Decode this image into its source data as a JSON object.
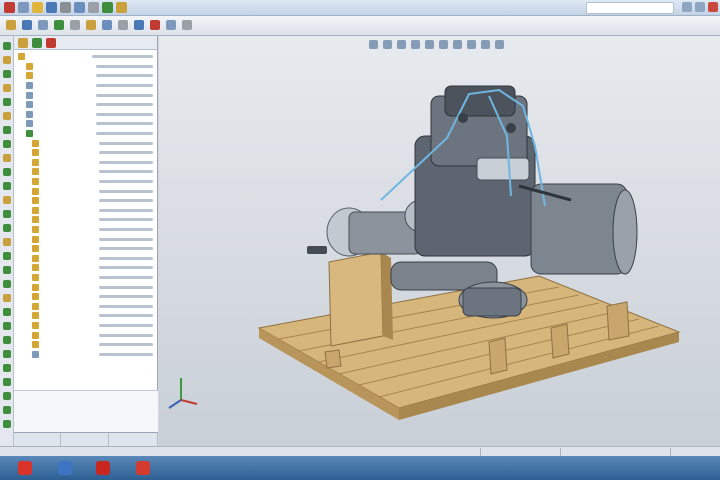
{
  "window": {
    "title": ""
  },
  "colors": {
    "accent": "#3e8e3e",
    "wood": "#d7b67c",
    "wood_shade": "#a9884f",
    "engine": "#8c939c",
    "engine_dark": "#454c56",
    "pipes": "#6fb6e0",
    "viewport_top": "#e7eaee",
    "viewport_bottom": "#c9cfd7"
  },
  "feature_tree": {
    "rows": [
      {
        "icon": "assembly-icon",
        "color": "#d4a636",
        "text": ""
      },
      {
        "icon": "folder-icon",
        "color": "#d4a636",
        "text": ""
      },
      {
        "icon": "folder-icon",
        "color": "#d4a636",
        "text": ""
      },
      {
        "icon": "sensor-icon",
        "color": "#7f9ab8",
        "text": ""
      },
      {
        "icon": "plane-icon",
        "color": "#7f9ab8",
        "text": ""
      },
      {
        "icon": "plane-icon",
        "color": "#7f9ab8",
        "text": ""
      },
      {
        "icon": "plane-icon",
        "color": "#7f9ab8",
        "text": ""
      },
      {
        "icon": "origin-icon",
        "color": "#7f9ab8",
        "text": ""
      },
      {
        "icon": "part-icon",
        "color": "#3e8e3e",
        "text": ""
      },
      {
        "icon": "part-icon",
        "color": "#d4a636",
        "text": ""
      },
      {
        "icon": "part-icon",
        "color": "#d4a636",
        "text": ""
      },
      {
        "icon": "part-icon",
        "color": "#d4a636",
        "text": ""
      },
      {
        "icon": "part-icon",
        "color": "#d4a636",
        "text": ""
      },
      {
        "icon": "part-icon",
        "color": "#d4a636",
        "text": ""
      },
      {
        "icon": "part-icon",
        "color": "#d4a636",
        "text": ""
      },
      {
        "icon": "part-icon",
        "color": "#d4a636",
        "text": ""
      },
      {
        "icon": "part-icon",
        "color": "#d4a636",
        "text": ""
      },
      {
        "icon": "part-icon",
        "color": "#d4a636",
        "text": ""
      },
      {
        "icon": "part-icon",
        "color": "#d4a636",
        "text": ""
      },
      {
        "icon": "part-icon",
        "color": "#d4a636",
        "text": ""
      },
      {
        "icon": "part-icon",
        "color": "#d4a636",
        "text": ""
      },
      {
        "icon": "part-icon",
        "color": "#d4a636",
        "text": ""
      },
      {
        "icon": "part-icon",
        "color": "#d4a636",
        "text": ""
      },
      {
        "icon": "part-icon",
        "color": "#d4a636",
        "text": ""
      },
      {
        "icon": "part-icon",
        "color": "#d4a636",
        "text": ""
      },
      {
        "icon": "part-icon",
        "color": "#d4a636",
        "text": ""
      },
      {
        "icon": "part-icon",
        "color": "#d4a636",
        "text": ""
      },
      {
        "icon": "part-icon",
        "color": "#d4a636",
        "text": ""
      },
      {
        "icon": "part-icon",
        "color": "#d4a636",
        "text": ""
      },
      {
        "icon": "part-icon",
        "color": "#d4a636",
        "text": ""
      },
      {
        "icon": "part-icon",
        "color": "#d4a636",
        "text": ""
      },
      {
        "icon": "mates-icon",
        "color": "#7f9ab8",
        "text": ""
      }
    ]
  },
  "bottom_tabs": [
    "",
    "",
    ""
  ],
  "taskbar": {
    "apps": [
      {
        "icon": "opera-icon",
        "color": "#d9332b"
      },
      {
        "icon": "floppy-icon",
        "color": "#3e74c4"
      },
      {
        "icon": "pdf-icon",
        "color": "#c8261f"
      },
      {
        "icon": "solidworks-icon",
        "color": "#d33b2f"
      }
    ],
    "tray_text": ""
  }
}
